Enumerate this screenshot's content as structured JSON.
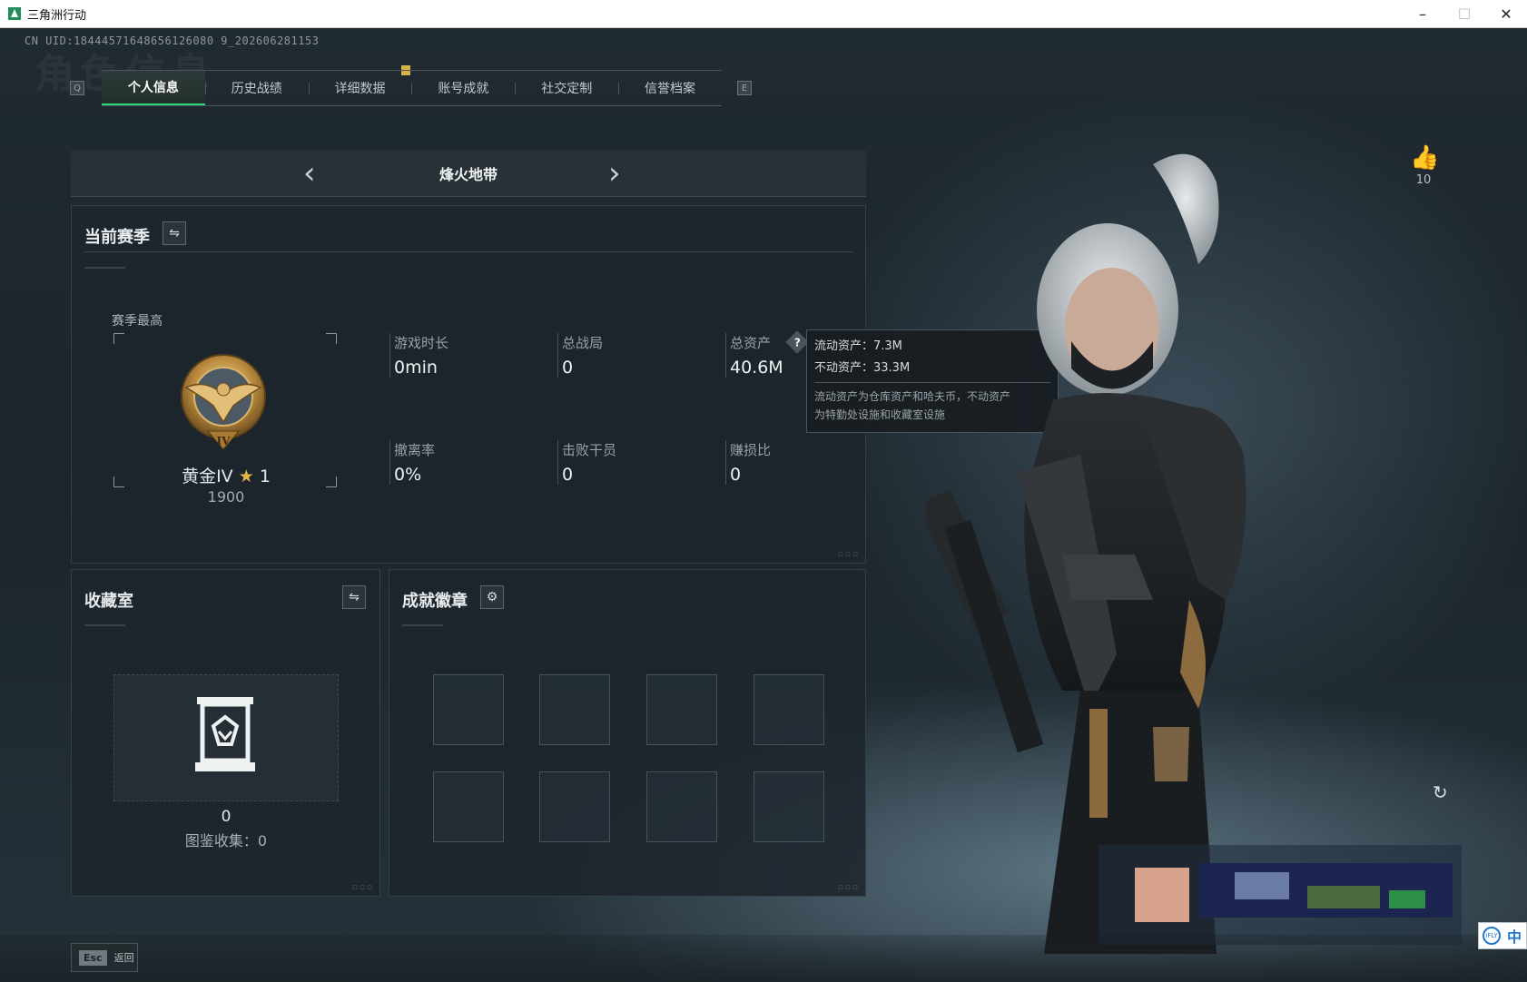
{
  "window": {
    "title": "三角洲行动",
    "minimize_glyph": "–",
    "maximize_glyph": "☐",
    "close_glyph": "✕"
  },
  "uid": "CN UID:18444571648656126080 9_202606281153",
  "background_title": "角色信息",
  "tabs": {
    "left_key": "Q",
    "right_key": "E",
    "items": [
      {
        "label": "个人信息",
        "active": true
      },
      {
        "label": "历史战绩",
        "active": false
      },
      {
        "label": "详细数据",
        "active": false
      },
      {
        "label": "账号成就",
        "active": false
      },
      {
        "label": "社交定制",
        "active": false
      },
      {
        "label": "信誉档案",
        "active": false
      }
    ]
  },
  "mode": {
    "title": "烽火地带",
    "prev_glyph": "‹",
    "next_glyph": "›"
  },
  "season": {
    "title": "当前赛季",
    "swap_glyph": "⇋",
    "best_label": "赛季最高",
    "rank_name": "黄金IV",
    "rank_star": "★",
    "rank_stars_count": "1",
    "rank_score": "1900",
    "rank_numeral": "IV",
    "stats": [
      {
        "label": "游戏时长",
        "value": "0min"
      },
      {
        "label": "总战局",
        "value": "0"
      },
      {
        "label": "总资产",
        "value": "40.6M"
      },
      {
        "label": "撤离率",
        "value": "0%"
      },
      {
        "label": "击败干员",
        "value": "0"
      },
      {
        "label": "赚损比",
        "value": "0"
      }
    ],
    "help_glyph": "?"
  },
  "tooltip": {
    "liquid": "流动资产：7.3M",
    "fixed": "不动资产：33.3M",
    "note_1": "流动资产为仓库资产和哈夫币，不动资产",
    "note_2": "为特勤处设施和收藏室设施"
  },
  "collection": {
    "title": "收藏室",
    "swap_glyph": "⇋",
    "count": "0",
    "label": "图鉴收集：0"
  },
  "badges": {
    "title": "成就徽章",
    "settings_glyph": "⚙"
  },
  "like": {
    "glyph": "👍",
    "count": "10"
  },
  "refresh_glyph": "↻",
  "esc": {
    "key": "Esc",
    "label": "返回"
  },
  "ime": {
    "logo": "iFLY",
    "text": "中"
  },
  "colors": {
    "accent_green": "#2fd47c",
    "gold": "#e3b64a",
    "ime_blue": "#1f77d2"
  }
}
